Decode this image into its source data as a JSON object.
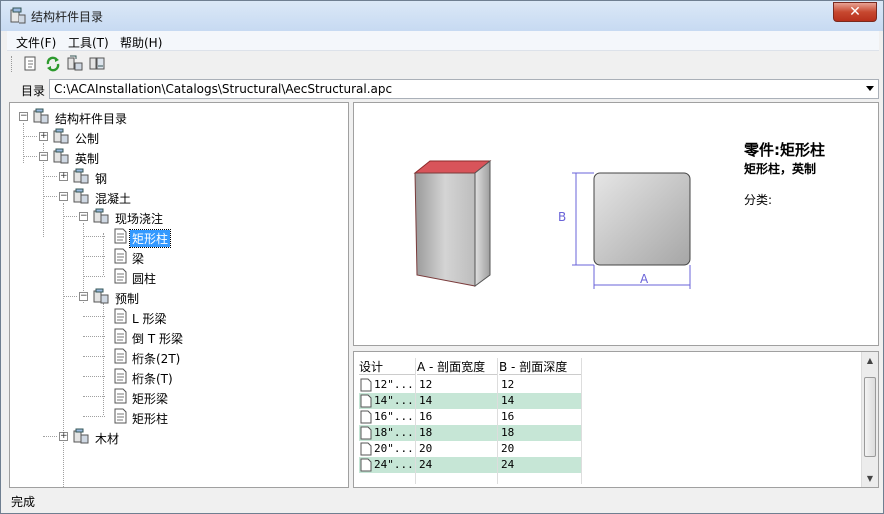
{
  "window": {
    "title": "结构杆件目录",
    "close_glyph": "✕"
  },
  "menu": [
    {
      "label": "文件(F)"
    },
    {
      "label": "工具(T)"
    },
    {
      "label": "帮助(H)"
    }
  ],
  "toolbar": {
    "icons": [
      "new-catalog-icon",
      "refresh-icon",
      "add-member-icon",
      "edit-member-icon"
    ]
  },
  "address": {
    "label": "目录",
    "value": "C:\\ACAInstallation\\Catalogs\\Structural\\AecStructural.apc"
  },
  "tree": {
    "root": "结构杆件目录",
    "items": {
      "metric": "公制",
      "imperial": "英制",
      "steel": "钢",
      "concrete": "混凝土",
      "cast_in_place": "现场浇注",
      "rect_column": "矩形柱",
      "beam": "梁",
      "round_column": "圆柱",
      "precast": "预制",
      "l_beam": "L 形梁",
      "inverted_t_beam": "倒 T 形梁",
      "purlin_2t": "桁条(2T)",
      "purlin_t": "桁条(T)",
      "rect_beam": "矩形梁",
      "rect_column_2": "矩形柱",
      "timber": "木材"
    }
  },
  "preview": {
    "title": "零件:矩形柱",
    "subtitle": "矩形柱，英制",
    "category_label": "分类:",
    "dim_b": "B",
    "dim_a": "A",
    "colors": {
      "top_face": "#d8545a",
      "dimension": "#6a63d8"
    }
  },
  "table": {
    "headers": [
      "设计",
      "A - 剖面宽度",
      "B - 剖面深度"
    ],
    "rows": [
      {
        "design": "12\"...",
        "a": "12",
        "b": "12"
      },
      {
        "design": "14\"...",
        "a": "14",
        "b": "14"
      },
      {
        "design": "16\"...",
        "a": "16",
        "b": "16"
      },
      {
        "design": "18\"...",
        "a": "18",
        "b": "18"
      },
      {
        "design": "20\"...",
        "a": "20",
        "b": "20"
      },
      {
        "design": "24\"...",
        "a": "24",
        "b": "24"
      }
    ],
    "alt_row_color": "#c6e6d6"
  },
  "status": {
    "text": "完成"
  }
}
